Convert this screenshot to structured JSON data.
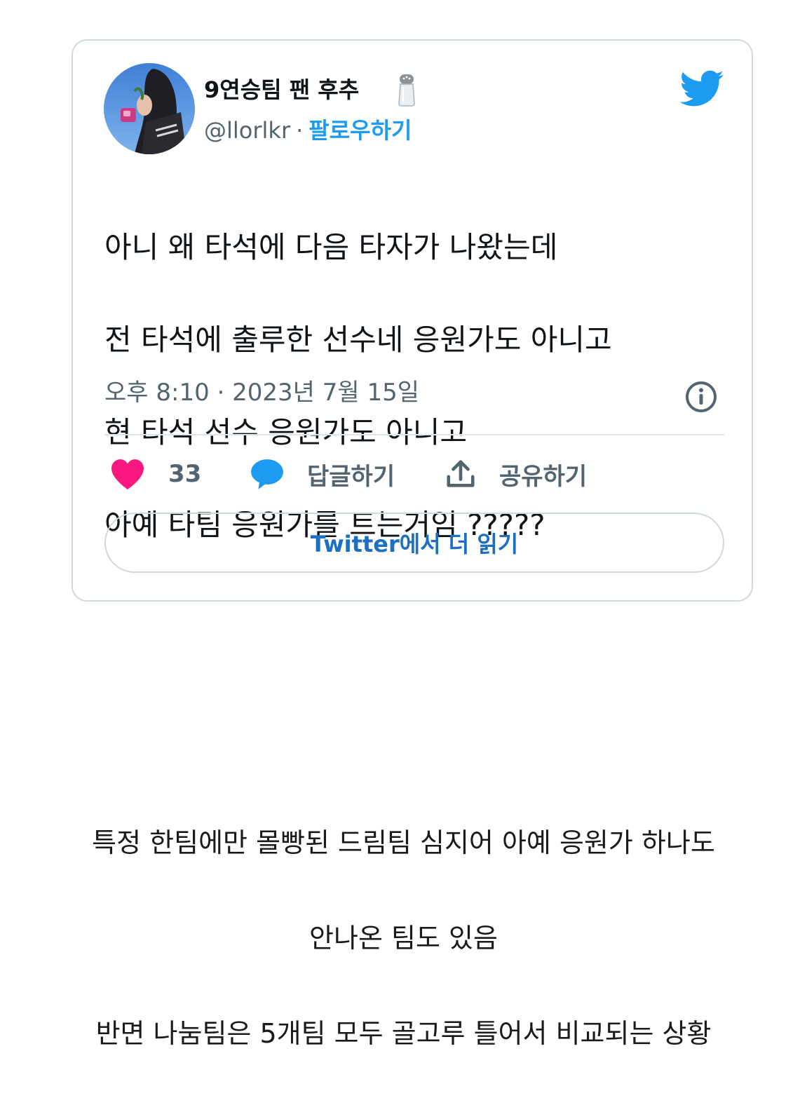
{
  "tweet": {
    "author": {
      "display_name": "9연승팀 팬 후추",
      "name_emoji": "salt-shaker-emoji",
      "handle": "@llorlkr",
      "separator": "·",
      "follow_label": "팔로우하기"
    },
    "brand_icon": "twitter-bird-icon",
    "text_lines": [
      "아니 왜 타석에 다음 타자가 나왔는데",
      "전 타석에 출루한 선수네 응원가도 아니고",
      "현 타석 선수 응원가도 아니고",
      "아예 타팀 응원가를 트는거임 ?????"
    ],
    "timestamp": "오후 8:10 · 2023년 7월 15일",
    "actions": {
      "like_count": "33",
      "reply_label": "답글하기",
      "share_label": "공유하기"
    },
    "read_more_label": "Twitter에서 더 읽기"
  },
  "caption_lines": [
    "특정 한팀에만 몰빵된 드림팀 심지어 아예 응원가 하나도",
    "안나온 팀도 있음",
    "반면 나눔팀은 5개팀 모두 골고루 틀어서 비교되는 상황"
  ],
  "colors": {
    "twitter_blue": "#1d9bf0",
    "like_pink": "#f91880",
    "secondary_text": "#536471",
    "border": "#cfd9de",
    "read_more_text": "#1d6fc2"
  }
}
